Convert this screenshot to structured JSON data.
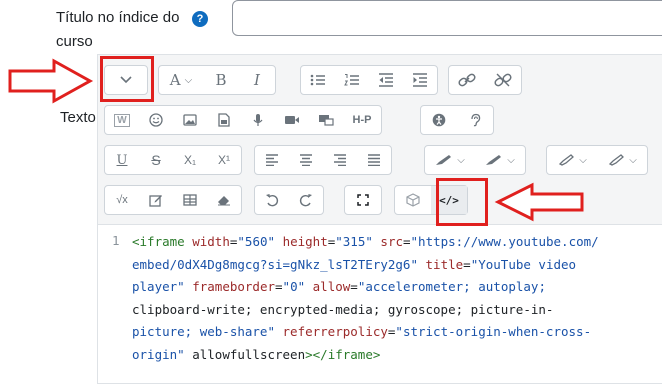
{
  "title_field": {
    "label": "Título no índice do curso",
    "help_icon": "question-circle-icon",
    "help_glyph": "?",
    "value": ""
  },
  "text_field": {
    "label": "Texto"
  },
  "toolbar": {
    "row1": [
      {
        "name": "collapse-toolbar",
        "icon": "chevron-down-icon"
      },
      {
        "name": "font-size",
        "icon": "text-size-icon",
        "glyph": "A"
      },
      {
        "name": "bold",
        "icon": "bold-icon",
        "glyph": "B"
      },
      {
        "name": "italic",
        "icon": "italic-icon",
        "glyph": "I"
      },
      {
        "name": "bullet-list",
        "icon": "bullet-list-icon"
      },
      {
        "name": "numbered-list",
        "icon": "numbered-list-icon"
      },
      {
        "name": "outdent",
        "icon": "outdent-icon"
      },
      {
        "name": "indent",
        "icon": "indent-icon"
      },
      {
        "name": "link",
        "icon": "link-icon"
      },
      {
        "name": "unlink",
        "icon": "unlink-icon"
      }
    ],
    "row2": [
      {
        "name": "word-paste",
        "icon": "word-icon"
      },
      {
        "name": "emoji",
        "icon": "emoji-icon"
      },
      {
        "name": "image",
        "icon": "image-icon"
      },
      {
        "name": "media",
        "icon": "file-icon"
      },
      {
        "name": "record-audio",
        "icon": "microphone-icon"
      },
      {
        "name": "record-video",
        "icon": "video-icon"
      },
      {
        "name": "screen",
        "icon": "screen-icon"
      },
      {
        "name": "h5p",
        "icon": "h5p-icon",
        "glyph": "H-P"
      },
      {
        "name": "accessibility-checker",
        "icon": "accessibility-icon"
      },
      {
        "name": "screen-reader",
        "icon": "ear-icon"
      }
    ],
    "row3": [
      {
        "name": "underline",
        "icon": "underline-icon",
        "glyph": "U"
      },
      {
        "name": "strikethrough",
        "icon": "strikethrough-icon",
        "glyph": "S"
      },
      {
        "name": "subscript",
        "icon": "subscript-icon",
        "glyph": "X₁"
      },
      {
        "name": "superscript",
        "icon": "superscript-icon",
        "glyph": "X¹"
      },
      {
        "name": "align-left",
        "icon": "align-left-icon"
      },
      {
        "name": "align-center",
        "icon": "align-center-icon"
      },
      {
        "name": "align-right",
        "icon": "align-right-icon"
      },
      {
        "name": "justify",
        "icon": "justify-icon"
      },
      {
        "name": "font-color",
        "icon": "pen-icon"
      },
      {
        "name": "background-color",
        "icon": "pen-icon"
      },
      {
        "name": "highlight-color",
        "icon": "marker-icon"
      },
      {
        "name": "highlight-color-2",
        "icon": "marker-icon"
      }
    ],
    "row4": [
      {
        "name": "equation",
        "icon": "sqrt-icon",
        "glyph": "√x"
      },
      {
        "name": "edit",
        "icon": "edit-icon"
      },
      {
        "name": "table",
        "icon": "table-icon"
      },
      {
        "name": "clear-formatting",
        "icon": "eraser-icon"
      },
      {
        "name": "undo",
        "icon": "undo-icon"
      },
      {
        "name": "redo",
        "icon": "redo-icon"
      },
      {
        "name": "fullscreen",
        "icon": "fullscreen-icon"
      },
      {
        "name": "manage-files",
        "icon": "cube-icon"
      },
      {
        "name": "html-source",
        "icon": "code-icon",
        "glyph": "</>"
      }
    ]
  },
  "code": {
    "line_number": "1",
    "source": "<iframe width=\"560\" height=\"315\" src=\"https://www.youtube.com/embed/0dX4Dg8mgcg?si=gNkz_lsT2TEry2g6\" title=\"YouTube video player\" frameborder=\"0\" allow=\"accelerometer; autoplay; clipboard-write; encrypted-media; gyroscope; picture-in-picture; web-share\" referrerpolicy=\"strict-origin-when-cross-origin\" allowfullscreen></iframe>",
    "wrapped_lines": [
      "<iframe width=\"560\" height=\"315\" src=\"https://www.youtube.com/",
      "embed/0dX4Dg8mgcg?si=gNkz_lsT2TEry2g6\" title=\"YouTube video",
      "player\" frameborder=\"0\" allow=\"accelerometer; autoplay;",
      "clipboard-write; encrypted-media; gyroscope; picture-in-",
      "picture; web-share\" referrerpolicy=\"strict-origin-when-cross-",
      "origin\" allowfullscreen></iframe>"
    ]
  },
  "colors": {
    "annotation_red": "#e0201e",
    "help_blue": "#0f6cbf",
    "toolbar_bg": "#f4f5f6",
    "code_tag": "#2a7a2a",
    "code_attr": "#9b2a2a",
    "code_string": "#1a52a8"
  }
}
